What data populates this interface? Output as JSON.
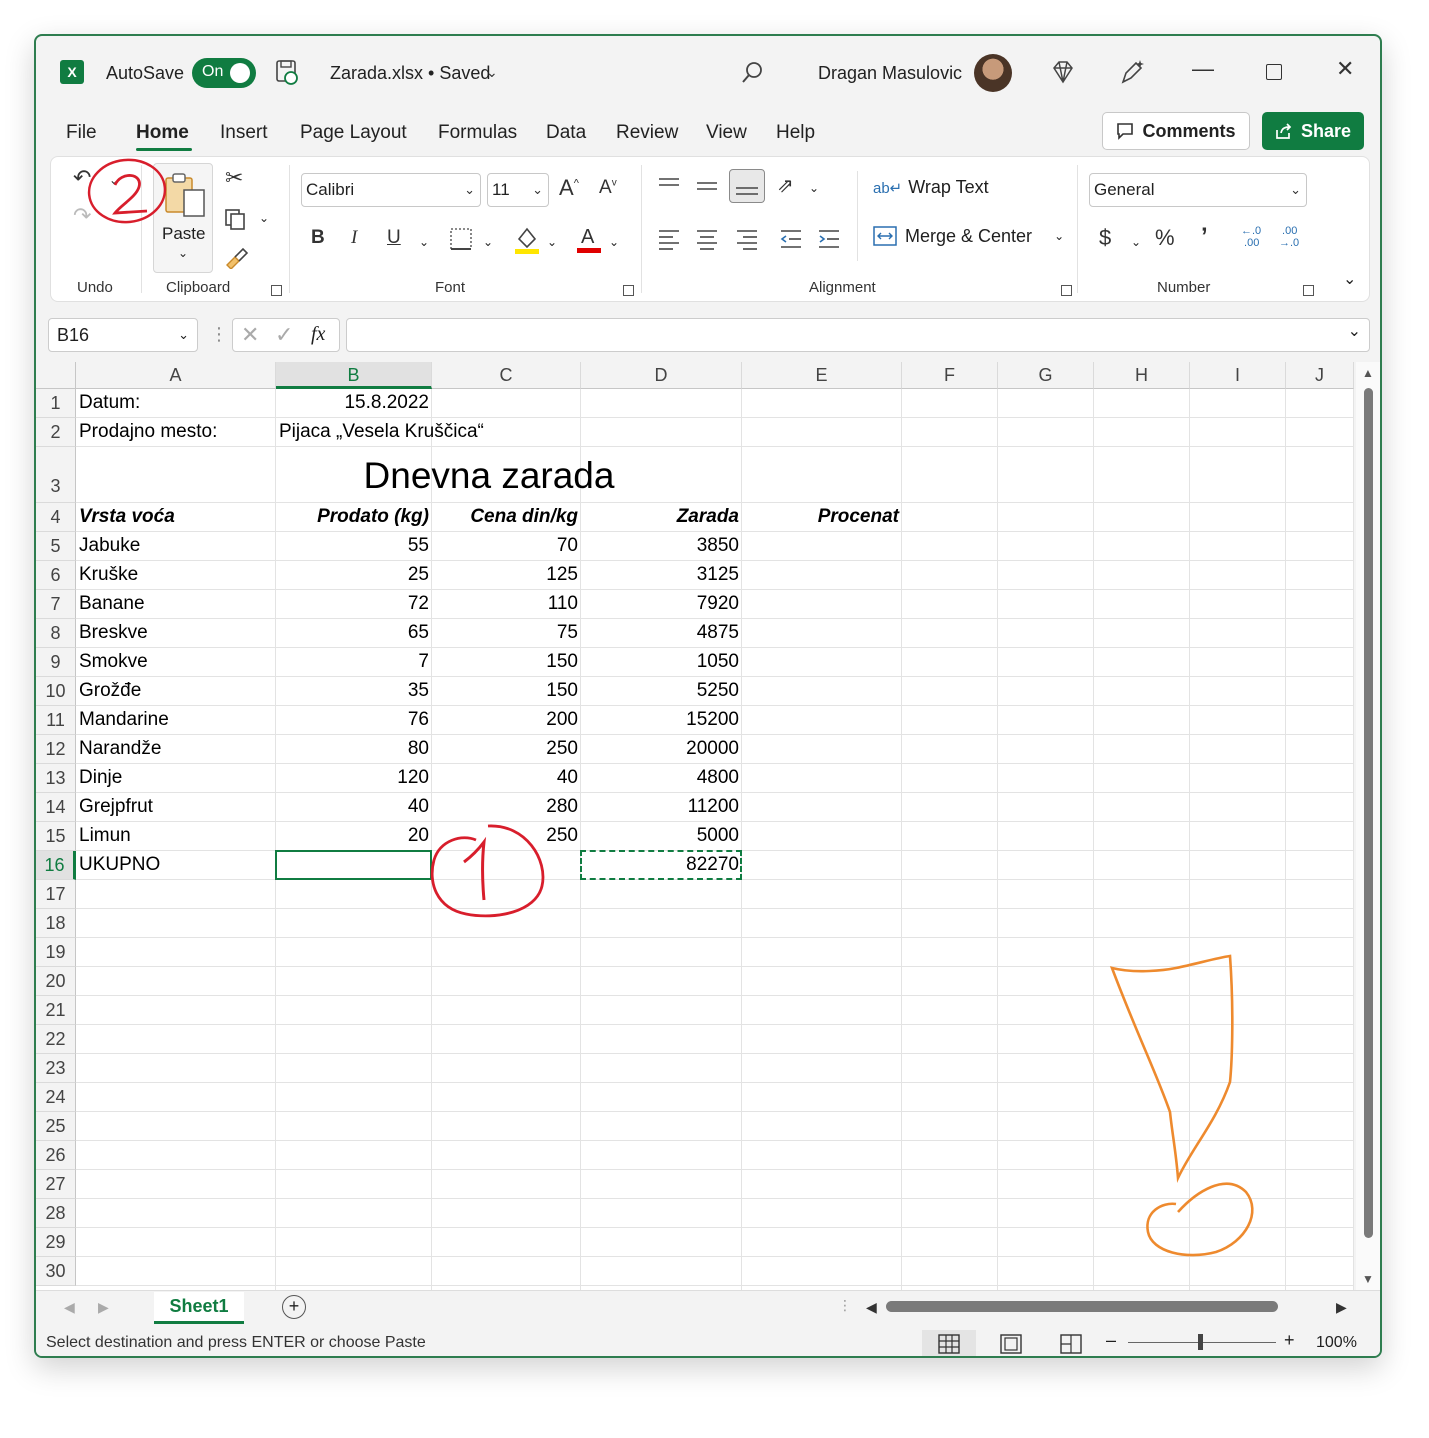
{
  "title_bar": {
    "autosave_label": "AutoSave",
    "autosave_state": "On",
    "file_title": "Zarada.xlsx • Saved",
    "user_name": "Dragan Masulovic"
  },
  "menu": {
    "items": [
      "File",
      "Home",
      "Insert",
      "Page Layout",
      "Formulas",
      "Data",
      "Review",
      "View",
      "Help"
    ],
    "active": "Home",
    "comments_label": "Comments",
    "share_label": "Share"
  },
  "ribbon": {
    "undo_label": "Undo",
    "clipboard_label": "Clipboard",
    "paste_label": "Paste",
    "font_label": "Font",
    "font_name": "Calibri",
    "font_size": "11",
    "alignment_label": "Alignment",
    "wrap_text_label": "Wrap Text",
    "merge_center_label": "Merge & Center",
    "number_label": "Number",
    "number_format": "General"
  },
  "formula_bar": {
    "name_box": "B16",
    "fx": "fx",
    "formula": ""
  },
  "sheet": {
    "columns": [
      "A",
      "B",
      "C",
      "D",
      "E",
      "F",
      "G",
      "H",
      "I",
      "J"
    ],
    "selected_column": "B",
    "selected_row": "16",
    "rows": [
      "1",
      "2",
      "3",
      "4",
      "5",
      "6",
      "7",
      "8",
      "9",
      "10",
      "11",
      "12",
      "13",
      "14",
      "15",
      "16",
      "17",
      "18",
      "19",
      "20",
      "21",
      "22",
      "23",
      "24",
      "25",
      "26",
      "27",
      "28",
      "29",
      "30"
    ],
    "date_label": "Datum:",
    "date_value": "15.8.2022",
    "place_label": "Prodajno mesto:",
    "place_value": "Pijaca „Vesela Kruščica“",
    "heading": "Dnevna zarada",
    "headers": [
      "Vrsta voća",
      "Prodato (kg)",
      "Cena din/kg",
      "Zarada",
      "Procenat"
    ],
    "data_rows": [
      {
        "name": "Jabuke",
        "kg": "55",
        "price": "70",
        "profit": "3850"
      },
      {
        "name": "Kruške",
        "kg": "25",
        "price": "125",
        "profit": "3125"
      },
      {
        "name": "Banane",
        "kg": "72",
        "price": "110",
        "profit": "7920"
      },
      {
        "name": "Breskve",
        "kg": "65",
        "price": "75",
        "profit": "4875"
      },
      {
        "name": "Smokve",
        "kg": "7",
        "price": "150",
        "profit": "1050"
      },
      {
        "name": "Grožđe",
        "kg": "35",
        "price": "150",
        "profit": "5250"
      },
      {
        "name": "Mandarine",
        "kg": "76",
        "price": "200",
        "profit": "15200"
      },
      {
        "name": "Narandže",
        "kg": "80",
        "price": "250",
        "profit": "20000"
      },
      {
        "name": "Dinje",
        "kg": "120",
        "price": "40",
        "profit": "4800"
      },
      {
        "name": "Grejpfrut",
        "kg": "40",
        "price": "280",
        "profit": "11200"
      },
      {
        "name": "Limun",
        "kg": "20",
        "price": "250",
        "profit": "5000"
      }
    ],
    "total_label": "UKUPNO",
    "total_value": "82270"
  },
  "tabs": {
    "sheet_name": "Sheet1"
  },
  "status": {
    "message": "Select destination and press ENTER or choose Paste",
    "zoom": "100%"
  },
  "annotations": {
    "red_color": "#d81e2c",
    "orange_color": "#ee8a2e"
  }
}
